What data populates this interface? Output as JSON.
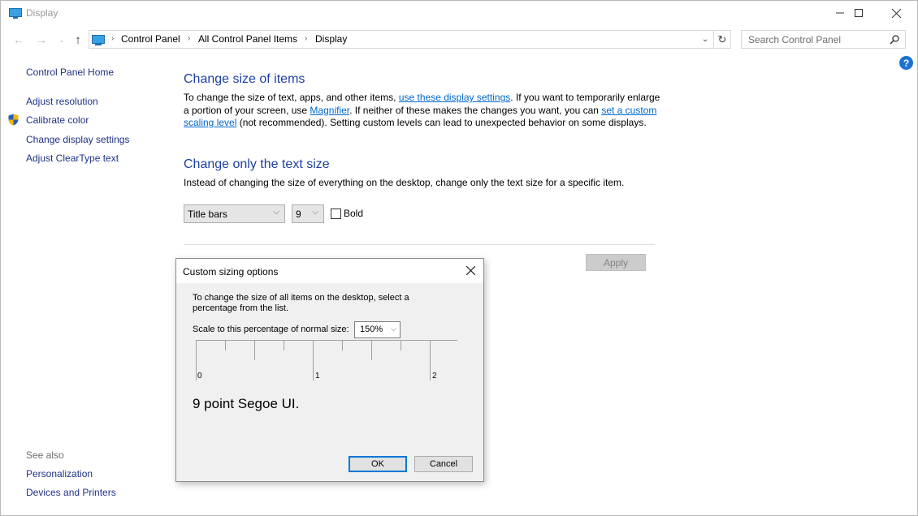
{
  "window": {
    "title": "Display",
    "controls": {
      "minimize": "—",
      "maximize": "☐",
      "close": "✕"
    }
  },
  "navigation": {
    "back_icon": "←",
    "forward_icon": "→",
    "recent_icon": "⌄",
    "up_icon": "↑",
    "breadcrumb": [
      "Control Panel",
      "All Control Panel Items",
      "Display"
    ],
    "separator": "›",
    "dropdown_icon": "⌄",
    "refresh_icon": "↻",
    "search_placeholder": "Search Control Panel",
    "search_icon": "⚲",
    "help_icon": "?"
  },
  "sidebar": {
    "home": "Control Panel Home",
    "items": [
      {
        "label": "Adjust resolution"
      },
      {
        "label": "Calibrate color",
        "icon": "uac-shield"
      },
      {
        "label": "Change display settings"
      },
      {
        "label": "Adjust ClearType text"
      }
    ],
    "see_also_label": "See also",
    "see_also": [
      "Personalization",
      "Devices and Printers"
    ]
  },
  "main": {
    "section1": {
      "heading": "Change size of items",
      "text_1": "To change the size of text, apps, and other items, ",
      "link_1": "use these display settings",
      "text_2": ".  If you want to temporarily enlarge a portion of your screen, use ",
      "link_2": "Magnifier",
      "text_3": ".  If neither of these makes the changes you want, you can ",
      "link_3": "set a custom scaling level",
      "text_4": " (not recommended).  Setting custom levels can lead to unexpected behavior on some displays."
    },
    "section2": {
      "heading": "Change only the text size",
      "description": "Instead of changing the size of everything on the desktop, change only the text size for a specific item.",
      "item_select": "Title bars",
      "size_select": "9",
      "bold_label": "Bold",
      "bold_checked": false
    },
    "apply_label": "Apply"
  },
  "dialog": {
    "title": "Custom sizing options",
    "close_icon": "✕",
    "instructions": "To change the size of all items on the desktop, select a percentage from the list.",
    "scale_label": "Scale to this percentage of normal size:",
    "scale_value": "150%",
    "ruler_labels": [
      "0",
      "1",
      "2"
    ],
    "sample_text": "9 point Segoe UI.",
    "ok_label": "OK",
    "cancel_label": "Cancel"
  }
}
